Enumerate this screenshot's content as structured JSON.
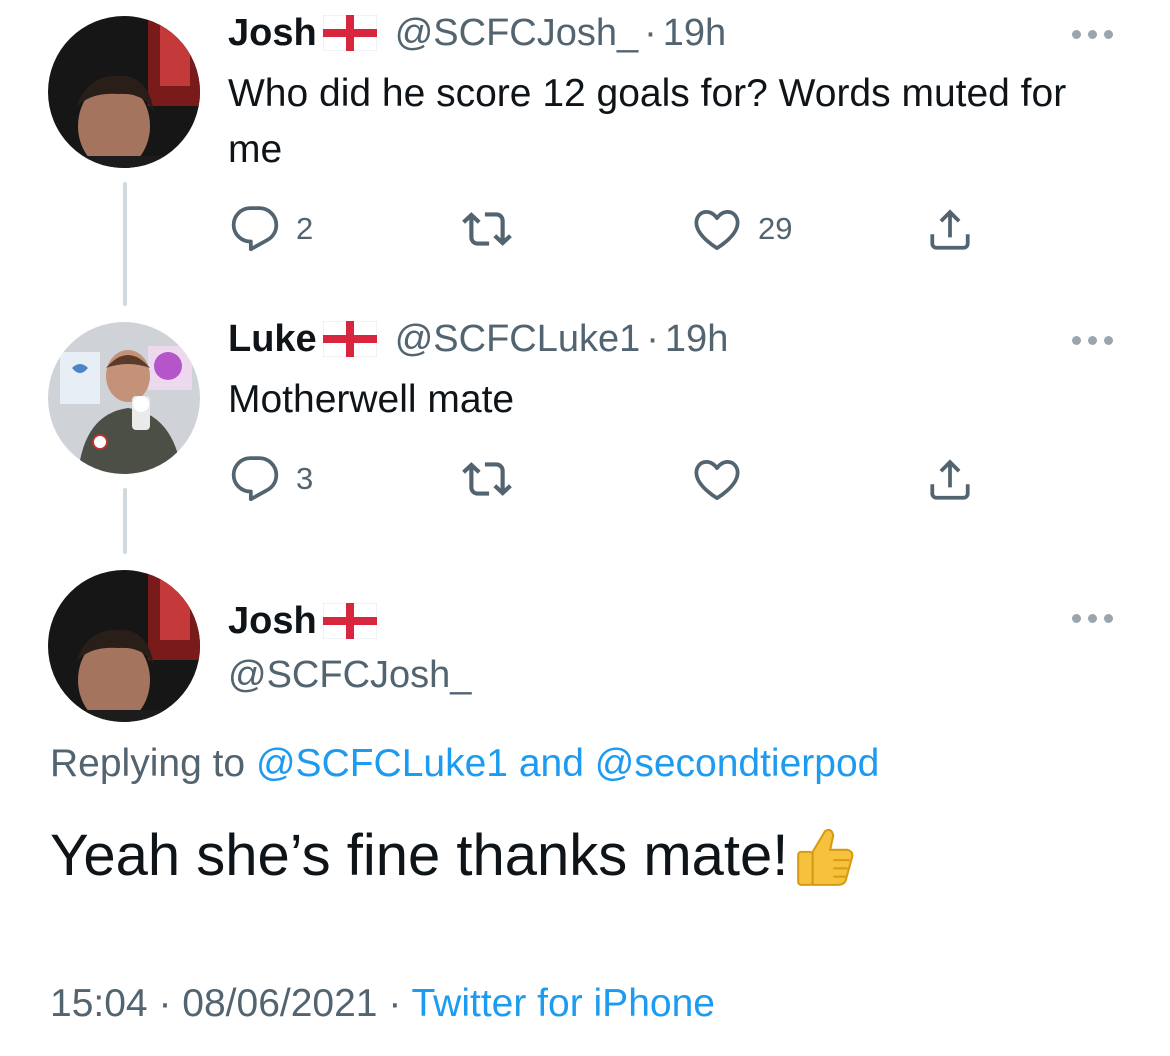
{
  "tweets": [
    {
      "name": "Josh",
      "handle": "@SCFCJosh_",
      "separator": "·",
      "time": "19h",
      "text": "Who did he score 12 goals for? Words muted for me",
      "replies": "2",
      "retweets": "",
      "likes": "29"
    },
    {
      "name": "Luke",
      "handle": "@SCFCLuke1",
      "separator": "·",
      "time": "19h",
      "text": "Motherwell mate",
      "replies": "3",
      "retweets": "",
      "likes": ""
    }
  ],
  "main": {
    "name": "Josh",
    "handle": "@SCFCJosh_",
    "replying_prefix": "Replying to",
    "replying_user1": "@SCFCLuke1",
    "replying_and": "and",
    "replying_user2": "@secondtierpod",
    "text": "Yeah she’s fine thanks mate!",
    "emoji": "thumbs-up-emoji",
    "time": "15:04",
    "separator1": "·",
    "date": "08/06/2021",
    "separator2": "·",
    "source": "Twitter for iPhone"
  },
  "icons": {
    "flag": "england-flag-icon",
    "reply": "reply-icon",
    "retweet": "retweet-icon",
    "like": "heart-icon",
    "share": "share-icon",
    "more": "more-icon"
  },
  "colors": {
    "link": "#1d9bf0",
    "secondary": "#536471",
    "thread_line": "#cfd9de"
  }
}
